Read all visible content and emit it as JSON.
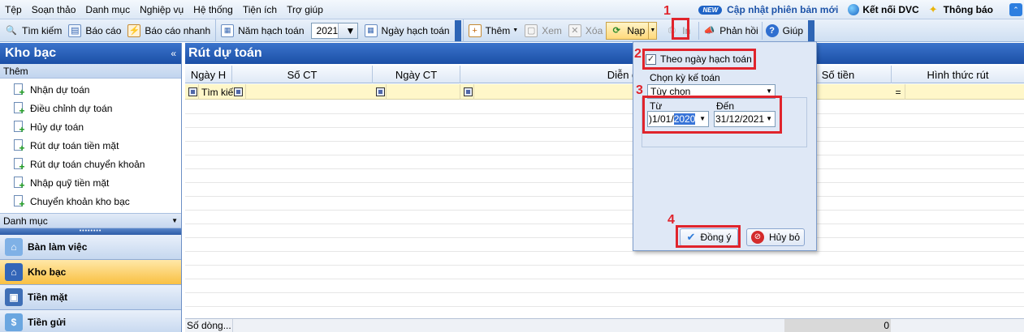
{
  "menu": [
    "Tệp",
    "Soạn thảo",
    "Danh mục",
    "Nghiệp vụ",
    "Hệ thống",
    "Tiện ích",
    "Trợ giúp"
  ],
  "menu_right": {
    "new_badge": "NEW",
    "update_label": "Cập nhật phiên bản mới",
    "connect_label": "Kết nối DVC",
    "notify_label": "Thông báo"
  },
  "toolbar": {
    "search": "Tìm kiếm",
    "report": "Báo cáo",
    "quick_report": "Báo cáo nhanh",
    "fiscal_year": "Năm hạch toán",
    "year_value": "2021",
    "posting_date": "Ngày hạch toán",
    "add": "Thêm",
    "view": "Xem",
    "delete": "Xóa",
    "load": "Nạp",
    "print": "In",
    "feedback": "Phản hồi",
    "help": "Giúp"
  },
  "sidebar": {
    "title": "Kho bạc",
    "section": "Thêm",
    "items": [
      "Nhận dự toán",
      "Điều chỉnh dự toán",
      "Hủy dự toán",
      "Rút dự toán tiền mặt",
      "Rút dự toán chuyển khoản",
      "Nhập quỹ tiền mặt",
      "Chuyển khoản kho bạc"
    ],
    "category": "Danh mục",
    "nav": [
      "Bàn làm việc",
      "Kho bạc",
      "Tiền mặt",
      "Tiền gửi"
    ]
  },
  "main": {
    "title": "Rút dự toán",
    "columns": [
      "Ngày H",
      "Số CT",
      "Ngày CT",
      "Diễn g",
      "Số tiền",
      "Hình thức rút"
    ],
    "filter_search": "Tìm kiế",
    "filter_eq": "=",
    "status_rows": "Số dòng...",
    "status_total": "0"
  },
  "popup": {
    "checkbox_label": "Theo ngày hạch toán",
    "period_label": "Chọn kỳ kế toán",
    "period_value": "Tùy chọn",
    "from_label": "Từ",
    "from_prefix": ")1/01/",
    "from_selected": "2020",
    "to_label": "Đến",
    "to_value": "31/12/2021",
    "ok": "Đồng ý",
    "cancel": "Hủy bỏ"
  },
  "annotations": [
    "1",
    "2",
    "3",
    "4"
  ],
  "colors": {
    "accent_blue": "#1b4fa6",
    "annotation_red": "#e0242c",
    "active_nav": "#f9c042"
  }
}
